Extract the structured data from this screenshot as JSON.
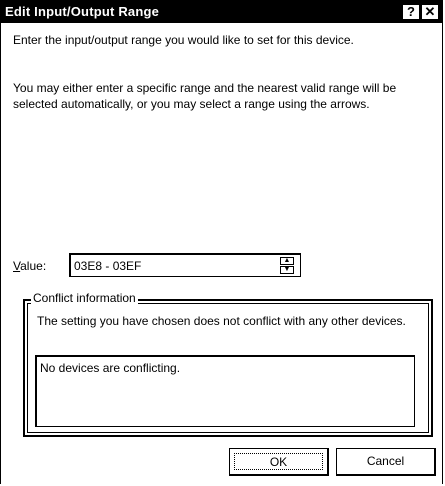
{
  "window": {
    "title": "Edit Input/Output Range",
    "help_label": "?",
    "close_label": "✕"
  },
  "instructions": {
    "para1": "Enter the input/output range you would like to set for this device.",
    "para2": "You may either enter a specific range and the nearest valid range will be selected automatically, or you may select a range using the arrows."
  },
  "value": {
    "label_accel": "V",
    "label_rest": "alue:",
    "current": "03E8 - 03EF"
  },
  "conflict": {
    "group_title": "Conflict information",
    "message": "The setting you have chosen does not conflict with any other devices.",
    "list_items": [
      "No devices are conflicting."
    ]
  },
  "buttons": {
    "ok_label": "OK",
    "cancel_label": "Cancel"
  }
}
